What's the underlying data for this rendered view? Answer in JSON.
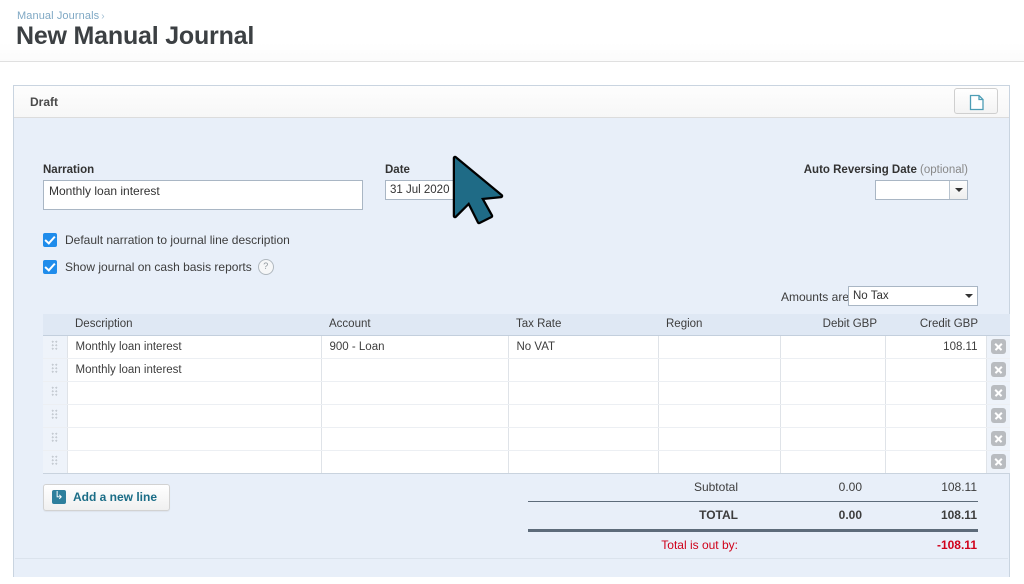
{
  "header": {
    "breadcrumb_label": "Manual Journals",
    "breadcrumb_separator": "›",
    "title": "New Manual Journal"
  },
  "panel": {
    "status_label": "Draft",
    "file_icon_name": "file-document-icon"
  },
  "form": {
    "narration_label": "Narration",
    "narration_value": "Monthly loan interest",
    "narration_placeholder": "",
    "date_label": "Date",
    "date_value": "31 Jul 2020",
    "date_placeholder": "",
    "auto_reversing_label": "Auto Reversing Date",
    "auto_reversing_optional": "(optional)",
    "auto_reversing_value": "",
    "auto_reversing_placeholder": "",
    "checkboxes": [
      {
        "label": "Default narration to journal line description",
        "checked": true,
        "has_help": false
      },
      {
        "label": "Show journal on cash basis reports",
        "checked": true,
        "has_help": true,
        "help_glyph": "?"
      }
    ]
  },
  "amounts": {
    "label": "Amounts are",
    "selected": "No Tax"
  },
  "table": {
    "columns": [
      {
        "key": "description",
        "label": "Description"
      },
      {
        "key": "account",
        "label": "Account"
      },
      {
        "key": "tax_rate",
        "label": "Tax Rate"
      },
      {
        "key": "region",
        "label": "Region"
      },
      {
        "key": "debit",
        "label": "Debit GBP"
      },
      {
        "key": "credit",
        "label": "Credit GBP"
      }
    ],
    "rows": [
      {
        "description": "Monthly loan interest",
        "account": "900 - Loan",
        "tax_rate": "No VAT",
        "region": "",
        "debit": "",
        "credit": "108.11"
      },
      {
        "description": "Monthly loan interest",
        "account": "",
        "tax_rate": "",
        "region": "",
        "debit": "",
        "credit": ""
      },
      {
        "description": "",
        "account": "",
        "tax_rate": "",
        "region": "",
        "debit": "",
        "credit": ""
      },
      {
        "description": "",
        "account": "",
        "tax_rate": "",
        "region": "",
        "debit": "",
        "credit": ""
      },
      {
        "description": "",
        "account": "",
        "tax_rate": "",
        "region": "",
        "debit": "",
        "credit": ""
      },
      {
        "description": "",
        "account": "",
        "tax_rate": "",
        "region": "",
        "debit": "",
        "credit": ""
      }
    ]
  },
  "footer": {
    "add_line_label": "Add a new line",
    "add_line_icon_name": "add-line-icon",
    "subtotal_label": "Subtotal",
    "subtotal_debit": "0.00",
    "subtotal_credit": "108.11",
    "total_label": "TOTAL",
    "total_debit": "0.00",
    "total_credit": "108.11",
    "out_by_label": "Total is out by:",
    "out_by_value": "-108.11"
  },
  "colors": {
    "panel_background": "#e8eff9",
    "accent_link": "#7fa8c4",
    "checkbox_blue": "#1f8ceb",
    "error_red": "#d0021b",
    "add_line_teal": "#1b6d87",
    "cursor_fill": "#1f6b86"
  }
}
